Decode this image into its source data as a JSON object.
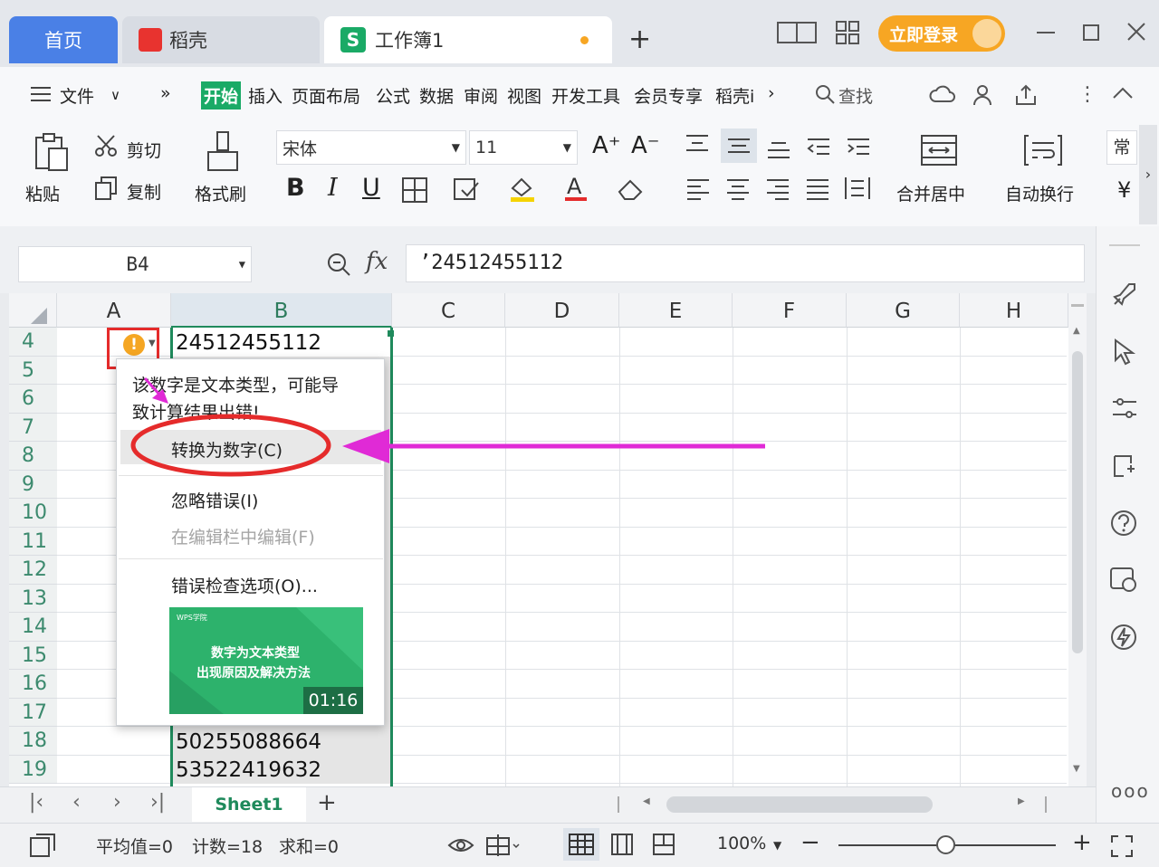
{
  "tabs": {
    "home": "首页",
    "daoke": "稻壳",
    "workbook": "工作簿1",
    "add": "+"
  },
  "window": {
    "login": "立即登录"
  },
  "menu": {
    "file": "文件",
    "more": "»",
    "items": [
      "开始",
      "插入",
      "页面布局",
      "公式",
      "数据",
      "审阅",
      "视图",
      "开发工具",
      "会员专享",
      "稻壳i"
    ],
    "search": "查找"
  },
  "ribbon": {
    "paste": "粘贴",
    "cut": "剪切",
    "copy": "复制",
    "format_painter": "格式刷",
    "font_name": "宋体",
    "font_size": "11",
    "bold": "B",
    "italic": "I",
    "underline": "U",
    "merge": "合并居中",
    "wrap": "自动换行",
    "number_format": "常",
    "currency": "¥"
  },
  "formula": {
    "cell_ref": "B4",
    "fx": "fx",
    "value": "’24512455112"
  },
  "grid": {
    "columns": [
      "A",
      "B",
      "C",
      "D",
      "E",
      "F",
      "G",
      "H"
    ],
    "rows": [
      "4",
      "5",
      "6",
      "7",
      "8",
      "9",
      "10",
      "11",
      "12",
      "13",
      "14",
      "15",
      "16",
      "17",
      "18",
      "19"
    ],
    "b4": "24512455112",
    "b18": "50255088664",
    "b19": "53522419632"
  },
  "popup": {
    "message_line1": "该数字是文本类型，可能导",
    "message_line2": "致计算结果出错!",
    "convert": "转换为数字(C)",
    "ignore": "忽略错误(I)",
    "edit_in_bar": "在编辑栏中编辑(F)",
    "options": "错误检查选项(O)...",
    "video_brand": "WPS学院",
    "video_title_line1": "数字为文本类型",
    "video_title_line2": "出现原因及解决方法",
    "video_duration": "01:16"
  },
  "sheets": {
    "active": "Sheet1",
    "add": "+"
  },
  "status": {
    "average": "平均值=0",
    "count": "计数=18",
    "sum": "求和=0",
    "zoom": "100%",
    "minus": "−",
    "plus": "+"
  },
  "colors": {
    "accent_blue": "#4a80e6",
    "wps_green": "#1aaa66",
    "login_orange": "#f7a623",
    "annotation_red": "#e52b2b",
    "annotation_magenta": "#e02ad6",
    "warning_orange": "#f5a623"
  }
}
